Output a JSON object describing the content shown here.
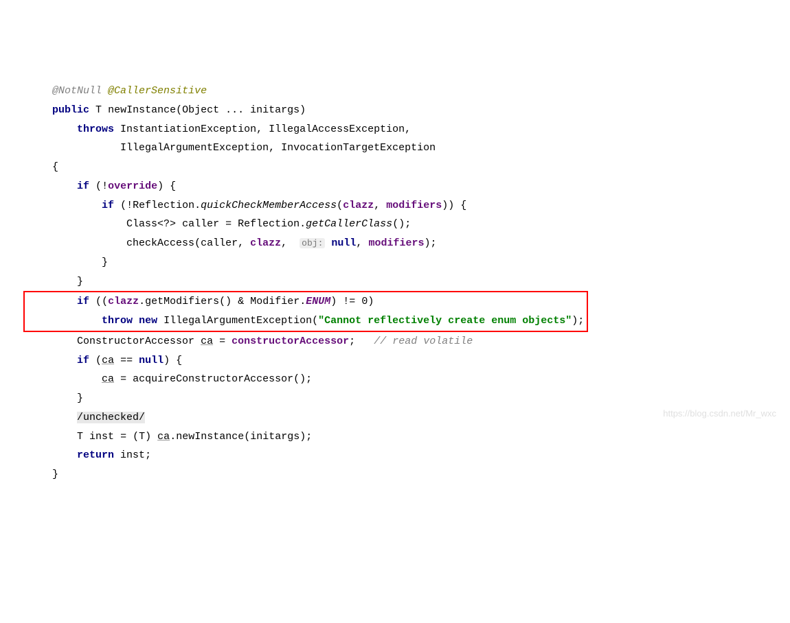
{
  "annotations": {
    "notnull": "@NotNull",
    "callersensitive": "@CallerSensitive"
  },
  "keywords": {
    "public": "public",
    "throws": "throws",
    "if": "if",
    "new": "new",
    "throw": "throw",
    "null": "null",
    "return": "return"
  },
  "types": {
    "T": "T",
    "object": "Object",
    "classwild": "Class<?>",
    "constructoraccessor": "ConstructorAccessor"
  },
  "method": {
    "name": "newInstance",
    "param": "initargs",
    "varargs": " ... "
  },
  "exceptions": {
    "line1": "InstantiationException, IllegalAccessException,",
    "line2": "IllegalArgumentException, InvocationTargetException"
  },
  "fields": {
    "override": "override",
    "clazz": "clazz",
    "modifiers": "modifiers",
    "constructoraccessor": "constructorAccessor"
  },
  "code": {
    "reflection": "Reflection",
    "quickcheck": "quickCheckMemberAccess",
    "caller": "caller",
    "getcallerclass": "getCallerClass",
    "checkaccess": "checkAccess",
    "objhint": "obj:",
    "getmodifiers": "getModifiers",
    "modifier": "Modifier",
    "enum": "ENUM",
    "illegalarg": "IllegalArgumentException",
    "string": "\"Cannot reflectively create enum objects\"",
    "ca": "ca",
    "acquireconstructor": "acquireConstructorAccessor",
    "unchecked": "/unchecked/",
    "inst": "inst",
    "newinstance2": "newInstance"
  },
  "comments": {
    "readvolatile": "// read volatile"
  },
  "punct": {
    "lbrace": "{",
    "rbrace": "}",
    "lparen": "(",
    "rparen": ")",
    "semi": ";",
    "comma": ",",
    "bang": "!",
    "amp": "&",
    "neq": "!=",
    "eqeq": "==",
    "assign": "=",
    "zero": "0",
    "dot": "."
  },
  "watermark": "https://blog.csdn.net/Mr_wxc"
}
